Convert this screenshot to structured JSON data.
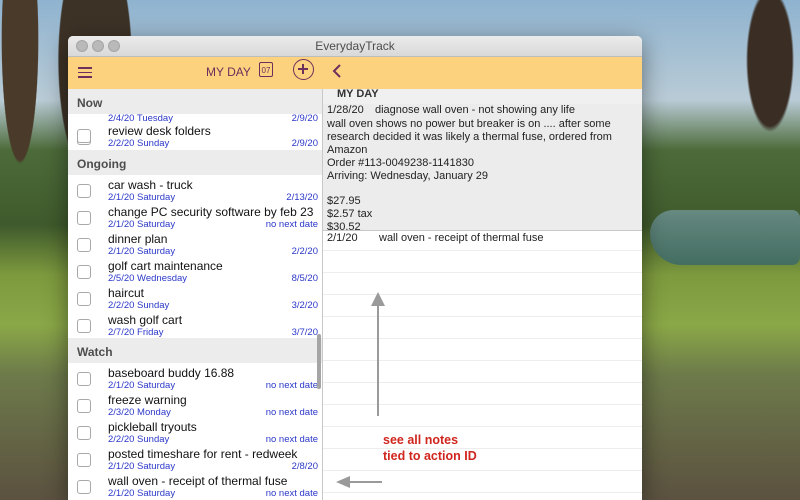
{
  "window": {
    "title": "EverydayTrack"
  },
  "toolbar": {
    "view_label": "MY DAY",
    "date_icon_text": "07"
  },
  "sections": [
    {
      "label": "Now",
      "items": [
        {
          "title": "",
          "start": "2/4/20 Tuesday",
          "next": "2/9/20"
        },
        {
          "title": "review desk folders",
          "start": "2/2/20 Sunday",
          "next": "2/9/20"
        }
      ]
    },
    {
      "label": "Ongoing",
      "items": [
        {
          "title": "car wash - truck",
          "start": "2/1/20 Saturday",
          "next": "2/13/20"
        },
        {
          "title": "change PC security software by feb 23",
          "start": "2/1/20 Saturday",
          "next": "no next date"
        },
        {
          "title": "dinner plan",
          "start": "2/1/20 Saturday",
          "next": "2/2/20"
        },
        {
          "title": "golf cart maintenance",
          "start": "2/5/20 Wednesday",
          "next": "8/5/20"
        },
        {
          "title": "haircut",
          "start": "2/2/20 Sunday",
          "next": "3/2/20"
        },
        {
          "title": "wash golf cart",
          "start": "2/7/20 Friday",
          "next": "3/7/20"
        }
      ]
    },
    {
      "label": "Watch",
      "items": [
        {
          "title": "baseboard buddy 16.88",
          "start": "2/1/20 Saturday",
          "next": "no next date"
        },
        {
          "title": "freeze warning",
          "start": "2/3/20 Monday",
          "next": "no next date"
        },
        {
          "title": "pickleball tryouts",
          "start": "2/2/20 Sunday",
          "next": "no next date"
        },
        {
          "title": "posted timeshare for rent - redweek",
          "start": "2/1/20 Saturday",
          "next": "2/8/20"
        },
        {
          "title": "wall oven - receipt of thermal fuse",
          "start": "2/1/20 Saturday",
          "next": "no next date"
        }
      ]
    }
  ],
  "detail": {
    "header": "MY DAY",
    "note1": {
      "date": "1/28/20",
      "title": "diagnose wall oven - not showing any life",
      "lines": [
        "wall oven shows no power  but breaker is on .... after some",
        "research decided it was likely a thermal fuse, ordered from",
        "Amazon",
        "Order #113-0049238-1141830",
        "Arriving: Wednesday, January 29",
        "",
        "$27.95",
        "$2.57 tax",
        "$30.52"
      ]
    },
    "note2": {
      "date": "2/1/20",
      "title": "wall oven - receipt of thermal fuse"
    }
  },
  "annotation": {
    "line1": "see all notes",
    "line2": "tied to action ID",
    "color": "#d0261e"
  },
  "colors": {
    "toolbar": "#fcd27f",
    "accent": "#6d2f5b",
    "date_text": "#2b38c9"
  }
}
